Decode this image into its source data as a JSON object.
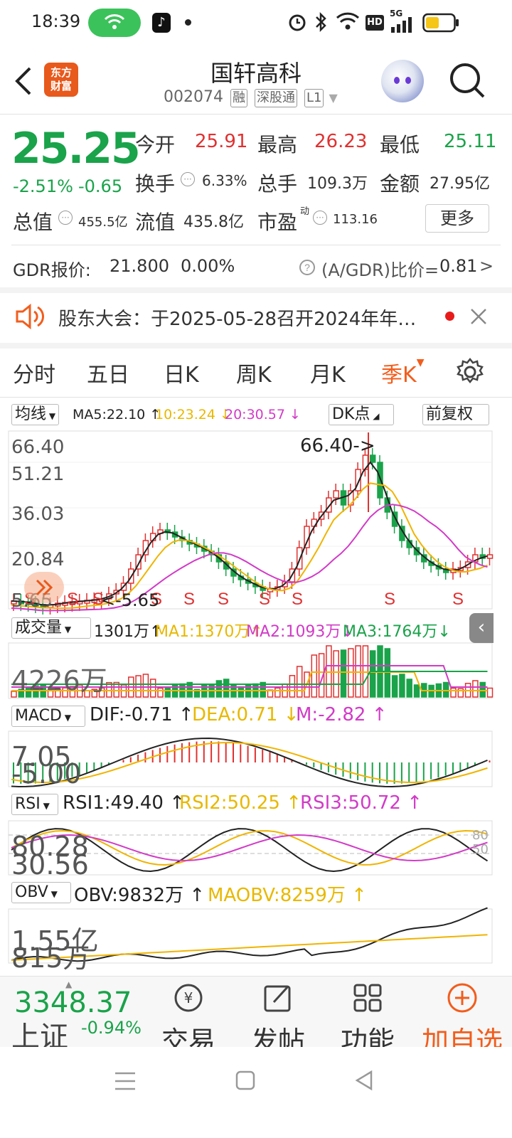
{
  "status_bar": {
    "time": "18:39",
    "icons": [
      "hotspot-icon",
      "tiktok-icon",
      "alarm-icon",
      "bluetooth-icon",
      "wifi-icon",
      "hd-icon",
      "5g-signal-icon",
      "battery-icon"
    ],
    "hd": "HD",
    "net": "5G"
  },
  "header": {
    "logo_line1": "东方",
    "logo_line2": "财富",
    "name": "国轩高科",
    "code": "002074",
    "tags": [
      "融",
      "深股通",
      "L1"
    ]
  },
  "quote": {
    "price": "25.25",
    "change_pct": "-2.51%",
    "change_amt": "-0.65",
    "open_label": "今开",
    "open": "25.91",
    "high_label": "最高",
    "high": "26.23",
    "low_label": "最低",
    "low": "25.11",
    "turnover_label": "换手",
    "turnover": "6.33%",
    "volume_label": "总手",
    "volume": "109.3万",
    "amount_label": "金额",
    "amount": "27.95亿",
    "mktcap_label": "总值",
    "mktcap": "455.5亿",
    "float_label": "流值",
    "float": "435.8亿",
    "pe_label": "市盈",
    "pe_sup": "动",
    "pe": "113.16",
    "more": "更多"
  },
  "gdr": {
    "label": "GDR报价:",
    "price": "21.800",
    "pct": "0.00%",
    "ratio_label": "(A/GDR)比价=",
    "ratio": "0.81",
    "arrow": ">"
  },
  "notice": {
    "text": "股东大会：于2025-05-28召开2024年年…"
  },
  "tabs": {
    "items": [
      "分时",
      "五日",
      "日K",
      "周K",
      "月K",
      "季K"
    ],
    "active": "季K"
  },
  "kline": {
    "ma_select": "均线",
    "ma5": "MA5:22.10",
    "ma10": "10:23.24",
    "ma20": "20:30.57",
    "dk": "DK点",
    "adjust": "前复权",
    "price_labels": [
      "66.40",
      "51.21",
      "36.03",
      "20.84",
      "5.65"
    ],
    "max_annot": "66.40->",
    "min_annot": "<-5.65",
    "signal": "S"
  },
  "volume": {
    "select": "成交量",
    "value": "1301万",
    "ma1": "MA1:1370万",
    "ma2": "MA2:1093万",
    "ma3": "MA3:1764万",
    "scale": "4226万"
  },
  "macd": {
    "select": "MACD",
    "dif": "DIF:-0.71",
    "dea": "DEA:0.71",
    "m": "M:-2.82",
    "top": "7.05",
    "bottom": "-5.00"
  },
  "rsi": {
    "select": "RSI",
    "rsi1": "RSI1:49.40",
    "rsi2": "RSI2:50.25",
    "rsi3": "RSI3:50.72",
    "top": "80.28",
    "bottom": "30.56",
    "ref80": "80",
    "ref50": "50"
  },
  "obv": {
    "select": "OBV",
    "obv": "OBV:9832万",
    "maobv": "MAOBV:8259万",
    "top": "1.55亿",
    "bottom": "815万"
  },
  "bottom_bar": {
    "index_value": "3348.37",
    "index_name": "上证",
    "index_chg": "-0.94%",
    "trade": "交易",
    "post": "发帖",
    "func": "功能",
    "add": "加自选"
  },
  "colors": {
    "up": "#e03131",
    "down": "#1aa34a",
    "ma_gold": "#f0b400",
    "ma_pink": "#d23bc7",
    "accent": "#f25d1c"
  }
}
